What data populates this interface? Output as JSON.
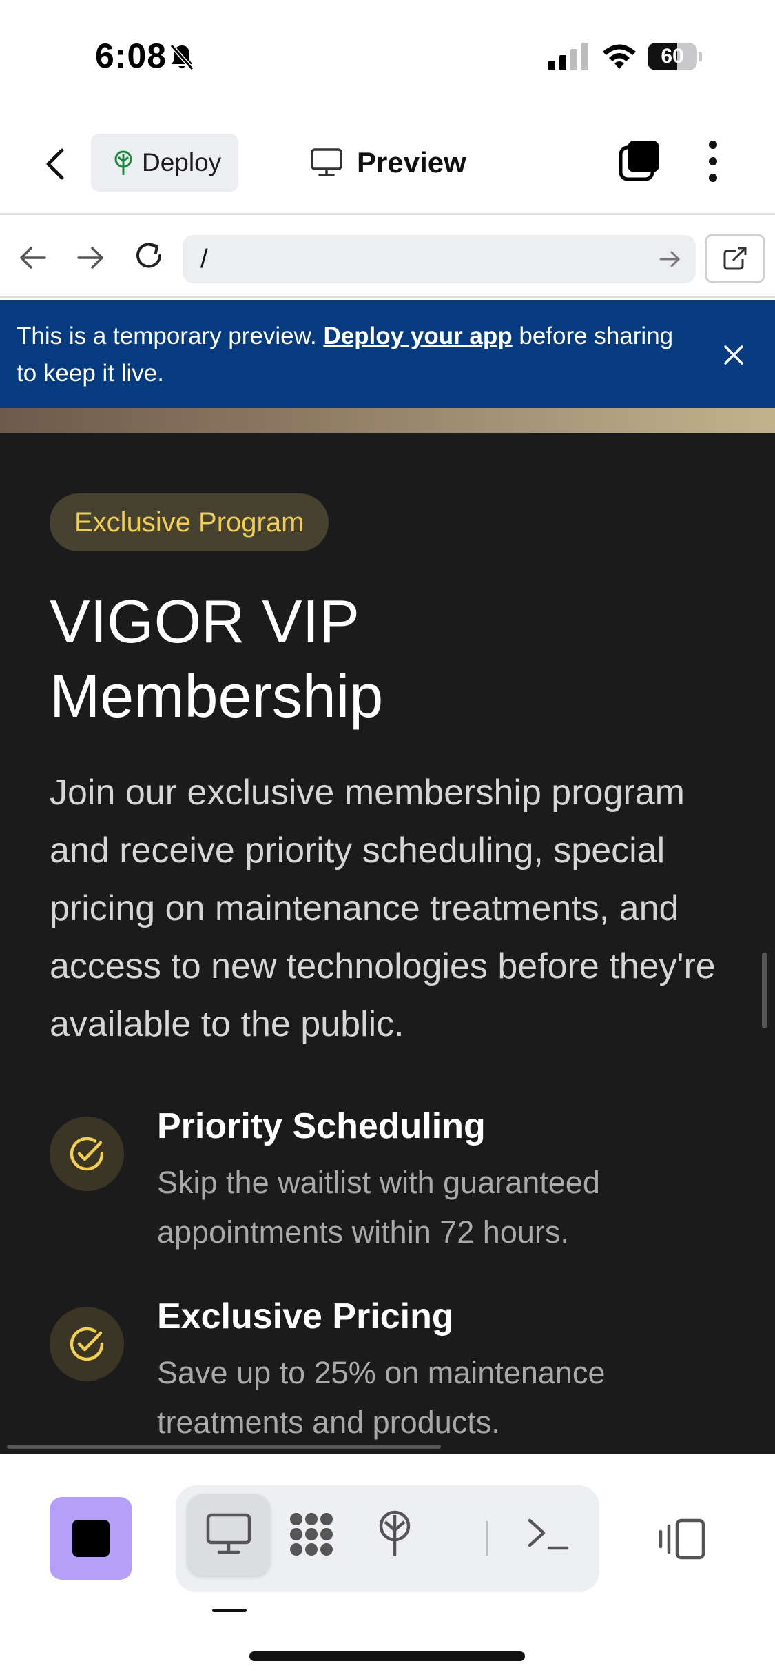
{
  "status_bar": {
    "time": "6:08",
    "battery": "60",
    "battery_level": 0.6
  },
  "header": {
    "deploy_label": "Deploy",
    "preview_label": "Preview"
  },
  "url_bar": {
    "value": "/"
  },
  "banner": {
    "text_before": "This is a temporary preview. ",
    "link_text": "Deploy your app",
    "text_after": " before sharing to keep it live."
  },
  "page": {
    "pill": "Exclusive Program",
    "title_line1": "VIGOR VIP",
    "title_line2": "Membership",
    "description": "Join our exclusive membership program and receive priority scheduling, special pricing on maintenance treatments, and access to new technologies before they're available to the public.",
    "features": [
      {
        "title": "Priority Scheduling",
        "description": "Skip the waitlist with guaranteed appointments within 72 hours."
      },
      {
        "title": "Exclusive Pricing",
        "description": "Save up to 25% on maintenance treatments and products."
      }
    ]
  },
  "colors": {
    "banner_bg": "#073b80",
    "content_bg": "#1b1b1b",
    "accent_gold": "#f2cf52",
    "stop_button": "#b4a0f8"
  },
  "icons": {
    "back": "chevron-left-icon",
    "deploy": "deploy-tree-icon",
    "preview": "monitor-icon",
    "tabs": "tabs-icon",
    "more": "more-vertical-icon",
    "check": "check-circle-icon",
    "terminal": "terminal-icon",
    "workflow": "workflow-icon",
    "panel": "panel-toggle-icon"
  }
}
